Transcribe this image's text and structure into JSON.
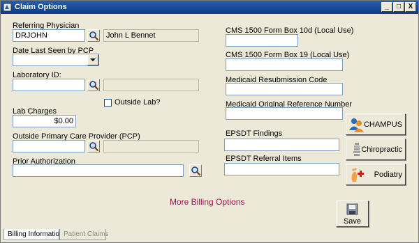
{
  "window": {
    "title": "Claim Options",
    "controls": {
      "minimize": "_",
      "maximize": "□",
      "close": "X"
    }
  },
  "left": {
    "referring_physician": {
      "label": "Referring Physician",
      "value": "DRJOHN",
      "name_display": "John L Bennet"
    },
    "date_last_seen": {
      "label": "Date Last Seen by PCP",
      "value": ""
    },
    "laboratory_id": {
      "label": "Laboratory ID:",
      "value": "",
      "description": ""
    },
    "outside_lab": {
      "label": "Outside Lab?",
      "checked": false
    },
    "lab_charges": {
      "label": "Lab Charges",
      "value": "$0.00"
    },
    "outside_pcp": {
      "label": "Outside Primary Care Provider (PCP)",
      "value": "",
      "description": ""
    },
    "prior_authorization": {
      "label": "Prior Authorization",
      "value": ""
    }
  },
  "right": {
    "cms_box_10d": {
      "label": "CMS 1500 Form Box 10d (Local Use)",
      "value": ""
    },
    "cms_box_19": {
      "label": "CMS 1500 Form Box 19 (Local Use)",
      "value": ""
    },
    "medicaid_resubmission": {
      "label": "Medicaid Resubmission Code",
      "value": ""
    },
    "medicaid_original_ref": {
      "label": "Medicaid Original Reference Number",
      "value": ""
    },
    "epsdt_findings": {
      "label": "EPSDT Findings",
      "value": ""
    },
    "epsdt_referral": {
      "label": "EPSDT Referral Items",
      "value": ""
    }
  },
  "side_buttons": {
    "champus": {
      "label": "CHAMPUS",
      "icon": "people-icon"
    },
    "chiropractic": {
      "label": "Chiropractic",
      "icon": "spine-icon"
    },
    "podiatry": {
      "label": "Podiatry",
      "icon": "foot-icon"
    }
  },
  "more_billing_options": "More Billing Options",
  "save": {
    "label": "Save",
    "icon": "floppy-disk-icon"
  },
  "tabs": [
    {
      "label": "Billing Information",
      "active": true
    },
    {
      "label": "Patient Claims",
      "active": false
    }
  ],
  "colors": {
    "title_bar": "#0b3a8a",
    "background": "#ece9d8",
    "more_link": "#a0175a"
  }
}
